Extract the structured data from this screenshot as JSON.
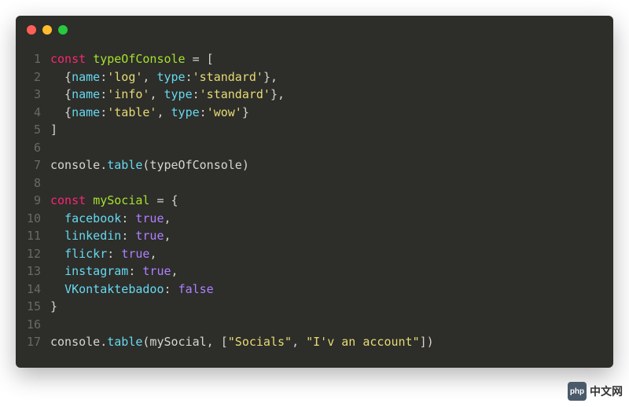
{
  "colors": {
    "background": "#2d2d2a",
    "keyword": "#f92672",
    "variable": "#a6e22e",
    "property": "#66d9ef",
    "string": "#e6db74",
    "boolean": "#ae81ff",
    "default": "#d6d6ce",
    "lineno": "#6a6a63",
    "tlRed": "#ff5f56",
    "tlYellow": "#ffbd2e",
    "tlGreen": "#27c93f"
  },
  "watermark": {
    "logo": "php",
    "text": "中文网"
  },
  "code": [
    {
      "n": "1",
      "tokens": [
        {
          "t": "const ",
          "c": "kw"
        },
        {
          "t": "typeOfConsole",
          "c": "var"
        },
        {
          "t": " = [",
          "c": "punct"
        }
      ]
    },
    {
      "n": "2",
      "tokens": [
        {
          "t": "  {",
          "c": "punct"
        },
        {
          "t": "name",
          "c": "prop"
        },
        {
          "t": ":",
          "c": "punct"
        },
        {
          "t": "'log'",
          "c": "str"
        },
        {
          "t": ", ",
          "c": "punct"
        },
        {
          "t": "type",
          "c": "prop"
        },
        {
          "t": ":",
          "c": "punct"
        },
        {
          "t": "'standard'",
          "c": "str"
        },
        {
          "t": "},",
          "c": "punct"
        }
      ]
    },
    {
      "n": "3",
      "tokens": [
        {
          "t": "  {",
          "c": "punct"
        },
        {
          "t": "name",
          "c": "prop"
        },
        {
          "t": ":",
          "c": "punct"
        },
        {
          "t": "'info'",
          "c": "str"
        },
        {
          "t": ", ",
          "c": "punct"
        },
        {
          "t": "type",
          "c": "prop"
        },
        {
          "t": ":",
          "c": "punct"
        },
        {
          "t": "'standard'",
          "c": "str"
        },
        {
          "t": "},",
          "c": "punct"
        }
      ]
    },
    {
      "n": "4",
      "tokens": [
        {
          "t": "  {",
          "c": "punct"
        },
        {
          "t": "name",
          "c": "prop"
        },
        {
          "t": ":",
          "c": "punct"
        },
        {
          "t": "'table'",
          "c": "str"
        },
        {
          "t": ", ",
          "c": "punct"
        },
        {
          "t": "type",
          "c": "prop"
        },
        {
          "t": ":",
          "c": "punct"
        },
        {
          "t": "'wow'",
          "c": "str"
        },
        {
          "t": "}",
          "c": "punct"
        }
      ]
    },
    {
      "n": "5",
      "tokens": [
        {
          "t": "]",
          "c": "punct"
        }
      ]
    },
    {
      "n": "6",
      "tokens": [
        {
          "t": "",
          "c": "punct"
        }
      ]
    },
    {
      "n": "7",
      "tokens": [
        {
          "t": "console",
          "c": "obj"
        },
        {
          "t": ".",
          "c": "punct"
        },
        {
          "t": "table",
          "c": "method"
        },
        {
          "t": "(typeOfConsole)",
          "c": "punct"
        }
      ]
    },
    {
      "n": "8",
      "tokens": [
        {
          "t": "",
          "c": "punct"
        }
      ]
    },
    {
      "n": "9",
      "tokens": [
        {
          "t": "const ",
          "c": "kw"
        },
        {
          "t": "mySocial",
          "c": "var"
        },
        {
          "t": " = {",
          "c": "punct"
        }
      ]
    },
    {
      "n": "10",
      "tokens": [
        {
          "t": "  ",
          "c": "punct"
        },
        {
          "t": "facebook",
          "c": "prop"
        },
        {
          "t": ": ",
          "c": "punct"
        },
        {
          "t": "true",
          "c": "bool"
        },
        {
          "t": ",",
          "c": "punct"
        }
      ]
    },
    {
      "n": "11",
      "tokens": [
        {
          "t": "  ",
          "c": "punct"
        },
        {
          "t": "linkedin",
          "c": "prop"
        },
        {
          "t": ": ",
          "c": "punct"
        },
        {
          "t": "true",
          "c": "bool"
        },
        {
          "t": ",",
          "c": "punct"
        }
      ]
    },
    {
      "n": "12",
      "tokens": [
        {
          "t": "  ",
          "c": "punct"
        },
        {
          "t": "flickr",
          "c": "prop"
        },
        {
          "t": ": ",
          "c": "punct"
        },
        {
          "t": "true",
          "c": "bool"
        },
        {
          "t": ",",
          "c": "punct"
        }
      ]
    },
    {
      "n": "13",
      "tokens": [
        {
          "t": "  ",
          "c": "punct"
        },
        {
          "t": "instagram",
          "c": "prop"
        },
        {
          "t": ": ",
          "c": "punct"
        },
        {
          "t": "true",
          "c": "bool"
        },
        {
          "t": ",",
          "c": "punct"
        }
      ]
    },
    {
      "n": "14",
      "tokens": [
        {
          "t": "  ",
          "c": "punct"
        },
        {
          "t": "VKontaktebadoo",
          "c": "prop"
        },
        {
          "t": ": ",
          "c": "punct"
        },
        {
          "t": "false",
          "c": "bool"
        }
      ]
    },
    {
      "n": "15",
      "tokens": [
        {
          "t": "}",
          "c": "punct"
        }
      ]
    },
    {
      "n": "16",
      "tokens": [
        {
          "t": "",
          "c": "punct"
        }
      ]
    },
    {
      "n": "17",
      "tokens": [
        {
          "t": "console",
          "c": "obj"
        },
        {
          "t": ".",
          "c": "punct"
        },
        {
          "t": "table",
          "c": "method"
        },
        {
          "t": "(mySocial, [",
          "c": "punct"
        },
        {
          "t": "\"Socials\"",
          "c": "str"
        },
        {
          "t": ", ",
          "c": "punct"
        },
        {
          "t": "\"I'v an account\"",
          "c": "str"
        },
        {
          "t": "])",
          "c": "punct"
        }
      ]
    }
  ]
}
